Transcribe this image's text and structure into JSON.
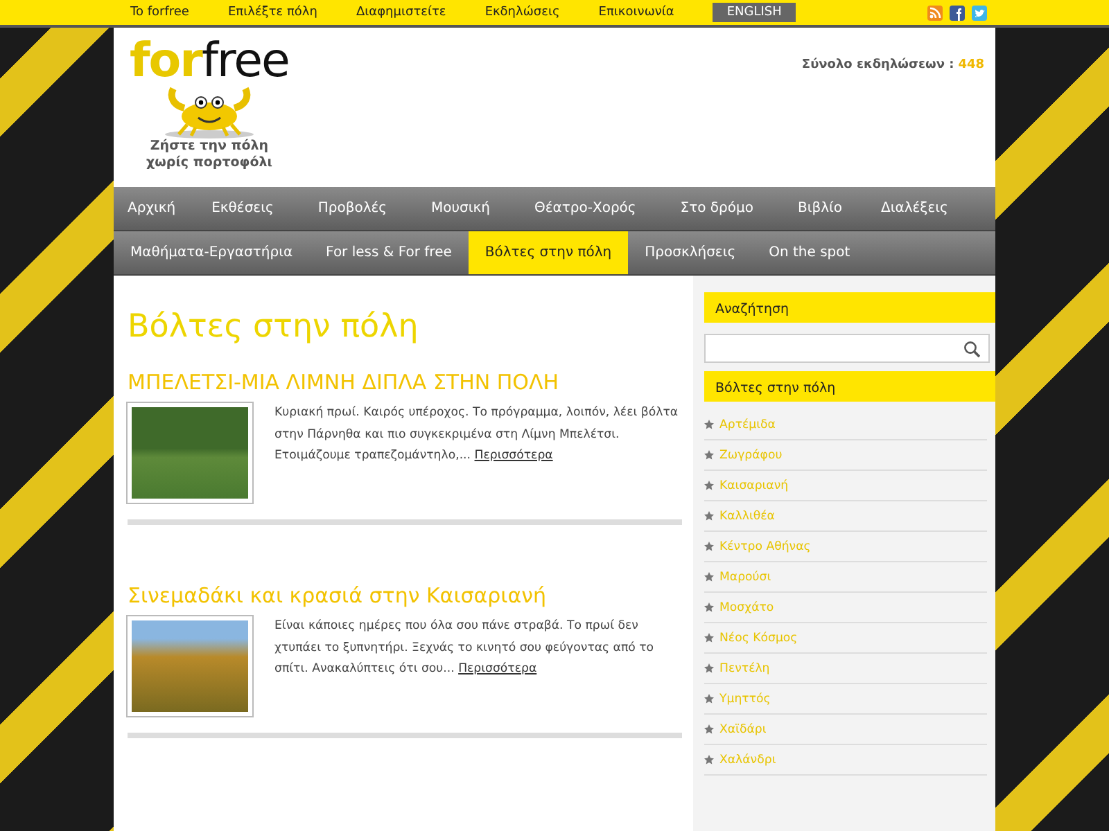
{
  "top_nav": {
    "links": [
      "To forfree",
      "Επιλέξτε πόλη",
      "Διαφημιστείτε",
      "Εκδηλώσεις",
      "Επικοινωνία"
    ],
    "language_button": "ENGLISH"
  },
  "header": {
    "logo": {
      "part_1": "for",
      "part_2": "free"
    },
    "tagline": [
      "Ζήστε την πόλη",
      "χωρίς πορτοφόλι"
    ],
    "event_total": {
      "label": "Σύνολο εκδηλώσεων :",
      "value": "448"
    }
  },
  "main_nav": [
    [
      {
        "label": "Αρχική",
        "selected": false
      },
      {
        "label": "Εκθέσεις",
        "selected": false
      },
      {
        "label": "Προβολές",
        "selected": false
      },
      {
        "label": "Μουσική",
        "selected": false
      },
      {
        "label": "Θέατρο-Χορός",
        "selected": false
      },
      {
        "label": "Στο δρόμο",
        "selected": false
      },
      {
        "label": "Βιβλίο",
        "selected": false
      },
      {
        "label": "Διαλέξεις",
        "selected": false
      }
    ],
    [
      {
        "label": "Μαθήματα-Εργαστήρια",
        "selected": false
      },
      {
        "label": "For less & For free",
        "selected": false
      },
      {
        "label": "Βόλτες στην πόλη",
        "selected": true
      },
      {
        "label": "Προσκλήσεις",
        "selected": false
      },
      {
        "label": "On the spot",
        "selected": false
      }
    ]
  ],
  "page_title": "Βόλτες στην πόλη",
  "articles": [
    {
      "title": "ΜΠΕΛΕΤΣΙ-ΜΙΑ ΛΙΜΝΗ ΔΙΠΛΑ ΣΤΗΝ ΠΟΛΗ",
      "excerpt": "Κυριακή πρωί. Καιρός υπέροχος. Το πρόγραμμα, λοιπόν, λέει βόλτα στην Πάρνηθα και πιο συγκεκριμένα στη Λίμνη Μπελέτσι. Ετοιμάζουμε τραπεζομάντηλο,...",
      "more": "Περισσότερα"
    },
    {
      "title": "Σινεμαδάκι και κρασιά στην Καισαριανή",
      "excerpt": "Είναι κάποιες ημέρες που όλα σου πάνε στραβά. Το πρωί δεν χτυπάει το ξυπνητήρι. Ξεχνάς το κινητό σου φεύγοντας από το σπίτι. Ανακαλύπτεις ότι σου...",
      "more": "Περισσότερα"
    }
  ],
  "sidebar": {
    "search_heading": "Αναζήτηση",
    "category_heading": "Βόλτες στην πόλη",
    "categories": [
      "Αρτέμιδα",
      "Ζωγράφου",
      "Καισαριανή",
      "Καλλιθέα",
      "Κέντρο Αθήνας",
      "Μαρούσι",
      "Μοσχάτο",
      "Νέος Κόσμος",
      "Πεντέλη",
      "Υμηττός",
      "Χαϊδάρι",
      "Χαλάνδρι"
    ]
  }
}
